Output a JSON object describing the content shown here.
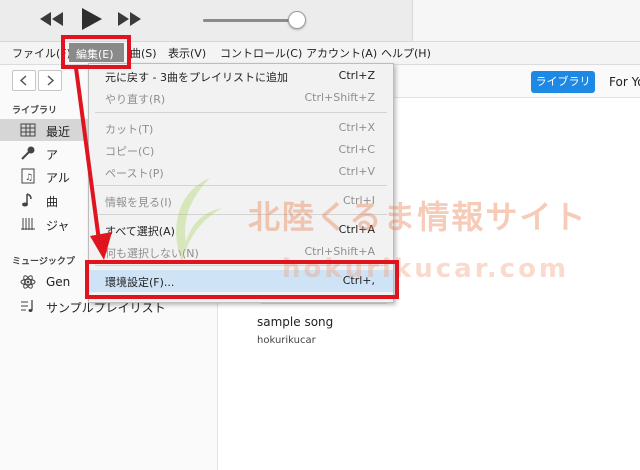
{
  "menubar": {
    "items": [
      "ファイル(F)",
      "編集(E)",
      "曲(S)",
      "表示(V)",
      "コントロール(C)",
      "アカウント(A)",
      "ヘルプ(H)"
    ]
  },
  "nav": {
    "library_button": "ライブラリ",
    "for_you": "For Yo"
  },
  "sidebar": {
    "library_header": "ライブラリ",
    "items": [
      {
        "label": "最近",
        "icon": "grid-icon"
      },
      {
        "label": "ア",
        "icon": "microphone-icon"
      },
      {
        "label": "アル",
        "icon": "album-icon"
      },
      {
        "label": "曲",
        "icon": "music-note-icon"
      },
      {
        "label": "ジャ",
        "icon": "guitar-icon"
      }
    ],
    "playlists_header": "ミュージックプ",
    "playlists": [
      {
        "label": "Gen",
        "icon": "atom-icon"
      },
      {
        "label": "サンプルプレイリスト",
        "icon": "playlist-icon"
      }
    ]
  },
  "edit_menu": {
    "items": [
      {
        "label": "元に戻す - 3曲をプレイリストに追加",
        "shortcut": "Ctrl+Z",
        "enabled": true
      },
      {
        "label": "やり直す(R)",
        "shortcut": "Ctrl+Shift+Z",
        "enabled": false
      },
      {
        "label": "カット(T)",
        "shortcut": "Ctrl+X",
        "enabled": false
      },
      {
        "label": "コピー(C)",
        "shortcut": "Ctrl+C",
        "enabled": false
      },
      {
        "label": "ペースト(P)",
        "shortcut": "Ctrl+V",
        "enabled": false
      },
      {
        "label": "情報を見る(I)",
        "shortcut": "Ctrl+I",
        "enabled": false
      },
      {
        "label": "すべて選択(A)",
        "shortcut": "Ctrl+A",
        "enabled": true
      },
      {
        "label": "何も選択しない(N)",
        "shortcut": "Ctrl+Shift+A",
        "enabled": false
      },
      {
        "label": "環境設定(F)...",
        "shortcut": "Ctrl+,",
        "enabled": true
      }
    ]
  },
  "content": {
    "song_title": "sample song",
    "song_artist": "hokurikucar"
  },
  "watermark": {
    "text_jp": "北陸くるま情報サイト",
    "text_url": "hokurikucar.com"
  },
  "colors": {
    "highlight_red": "#e0141e",
    "accent_blue": "#1e88e5",
    "menu_selected_gray": "#8a8a8a"
  }
}
